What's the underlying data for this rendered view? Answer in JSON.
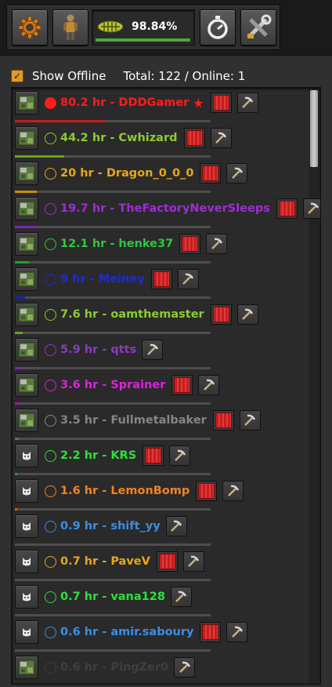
{
  "toolbar": {
    "progress_text": "98.84%",
    "progress_fraction": 0.9884,
    "icons": [
      "gear-icon",
      "character-icon",
      "research-pack-icon",
      "stopwatch-icon",
      "tools-icon"
    ]
  },
  "panel": {
    "show_offline_label": "Show Offline",
    "show_offline_checked": true,
    "total_text": "Total: 122 / Online: 1"
  },
  "players": [
    {
      "label": "80.2 hr - DDDGamer",
      "color": "#ff1c1c",
      "online": true,
      "star": "★",
      "flag": true,
      "avatar": "map",
      "line": 0.46,
      "line_color": "#c81c1c"
    },
    {
      "label": "44.2 hr - Cwhizard",
      "color": "#8ccc30",
      "online": false,
      "star": "",
      "flag": true,
      "avatar": "map",
      "line": 0.25,
      "line_color": "#6aa020"
    },
    {
      "label": "20 hr - Dragon_0_0_0",
      "color": "#e6a620",
      "online": false,
      "star": "",
      "flag": true,
      "avatar": "map",
      "line": 0.11,
      "line_color": "#c98e10"
    },
    {
      "label": "19.7 hr - TheFactoryNeverSleeps",
      "color": "#9b2fd0",
      "online": false,
      "star": "",
      "flag": true,
      "avatar": "map",
      "line": 0.11,
      "line_color": "#7d24ad"
    },
    {
      "label": "12.1 hr - henke37",
      "color": "#2ec83c",
      "online": false,
      "star": "",
      "flag": true,
      "avatar": "map",
      "line": 0.07,
      "line_color": "#22a030"
    },
    {
      "label": "9 hr - Meiney",
      "color": "#1c2ad8",
      "online": false,
      "star": "",
      "flag": true,
      "avatar": "map",
      "line": 0.05,
      "line_color": "#1422b0"
    },
    {
      "label": "7.6 hr - oamthemaster",
      "color": "#8ccc30",
      "online": false,
      "star": "",
      "flag": true,
      "avatar": "map",
      "line": 0.04,
      "line_color": "#6aa020"
    },
    {
      "label": "5.9 hr - qtts",
      "color": "#8a3ac0",
      "online": false,
      "star": "",
      "flag": false,
      "avatar": "map",
      "line": 0.03,
      "line_color": "#7a24ad"
    },
    {
      "label": "3.6 hr - Sprainer",
      "color": "#e020e0",
      "online": false,
      "star": "",
      "flag": true,
      "avatar": "map",
      "line": 0.02,
      "line_color": "#a418a4"
    },
    {
      "label": "3.5 hr - Fullmetalbaker",
      "color": "#858585",
      "online": false,
      "star": "",
      "flag": true,
      "avatar": "map",
      "line": 0.02,
      "line_color": "#6a6a6a"
    },
    {
      "label": "2.2 hr - KRS",
      "color": "#2ee03c",
      "online": false,
      "star": "",
      "flag": true,
      "avatar": "cat",
      "line": 0.01,
      "line_color": "#22a030"
    },
    {
      "label": "1.6 hr - LemonBomp",
      "color": "#ee8420",
      "online": false,
      "star": "",
      "flag": true,
      "avatar": "cat",
      "line": 0.01,
      "line_color": "#c06a10"
    },
    {
      "label": "0.9 hr - shift_yy",
      "color": "#3a8ee6",
      "online": false,
      "star": "",
      "flag": false,
      "avatar": "cat",
      "line": 0.0,
      "line_color": "#2a6eb6"
    },
    {
      "label": "0.7 hr - PaveV",
      "color": "#e6a620",
      "online": false,
      "star": "",
      "flag": true,
      "avatar": "cat",
      "line": 0.0,
      "line_color": "#c98e10"
    },
    {
      "label": "0.7 hr - vana128",
      "color": "#2ee03c",
      "online": false,
      "star": "",
      "flag": false,
      "avatar": "cat",
      "line": 0.0,
      "line_color": "#22a030"
    },
    {
      "label": "0.6 hr - amir.saboury",
      "color": "#3a8ee6",
      "online": false,
      "star": "",
      "flag": true,
      "avatar": "cat",
      "line": 0.0,
      "line_color": "#2a6eb6"
    },
    {
      "label": "0.6 hr - PingZer0",
      "color": "#3f3f3f",
      "online": false,
      "star": "",
      "flag": false,
      "avatar": "map",
      "line": 0.0,
      "line_color": "#333333"
    }
  ]
}
